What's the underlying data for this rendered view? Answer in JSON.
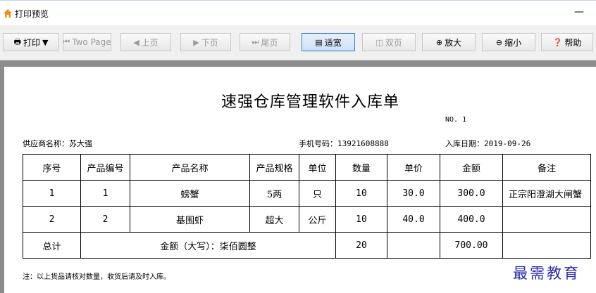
{
  "window": {
    "title": "打印预览",
    "minimize_glyph": "—"
  },
  "toolbar": {
    "print": "打印",
    "print_dropdown": "▼",
    "two_page": "Two Page",
    "prev": "上页",
    "next": "下页",
    "last": "尾页",
    "fit_width": "适宽",
    "double_page": "双页",
    "zoom_in": "放大",
    "zoom_out": "缩小",
    "help": "帮助"
  },
  "document": {
    "title": "速强仓库管理软件入库单",
    "no_text": "NO. 1",
    "supplier_label": "供应商名称：",
    "supplier_value": "苏大强",
    "phone_label": "手机号码：",
    "phone_value": "13921608888",
    "date_label": "入库日期：",
    "date_value": "2019-09-26",
    "headers": [
      "序号",
      "产品编号",
      "产品名称",
      "产品规格",
      "单位",
      "数量",
      "单价",
      "金额",
      "备注"
    ],
    "rows": [
      [
        "1",
        "1",
        "螃蟹",
        "5两",
        "只",
        "10",
        "30.0",
        "300.0",
        "正宗阳澄湖大闸蟹"
      ],
      [
        "2",
        "2",
        "基围虾",
        "超大",
        "公斤",
        "10",
        "40.0",
        "400.0",
        ""
      ]
    ],
    "total": {
      "label": "总计",
      "amount_words": "金额（大写）：柒佰圆整",
      "qty": "20",
      "unit_price": "",
      "amount": "700.00",
      "remark": ""
    },
    "note": "注：以上货品请核对数量，收货后请及时入库。"
  },
  "watermark": "最需教育",
  "colors": {
    "watermark": "#2a2ab8",
    "preview_bg": "#8c8c8c",
    "pressed_border": "#3d7dd8"
  }
}
